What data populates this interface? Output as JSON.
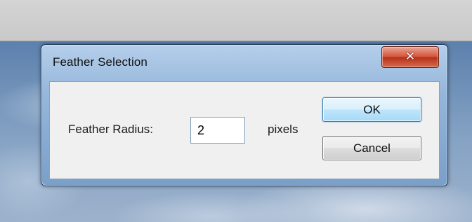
{
  "dialog": {
    "title": "Feather Selection",
    "close_icon": "close-icon",
    "close_glyph": "✕"
  },
  "form": {
    "radius_label": "Feather Radius:",
    "radius_value": "2",
    "unit_label": "pixels"
  },
  "buttons": {
    "ok_label": "OK",
    "cancel_label": "Cancel"
  },
  "colors": {
    "close_button": "#c9432a",
    "ok_button_border": "#3c7fb1",
    "title_bar": "#9ab9dc"
  }
}
